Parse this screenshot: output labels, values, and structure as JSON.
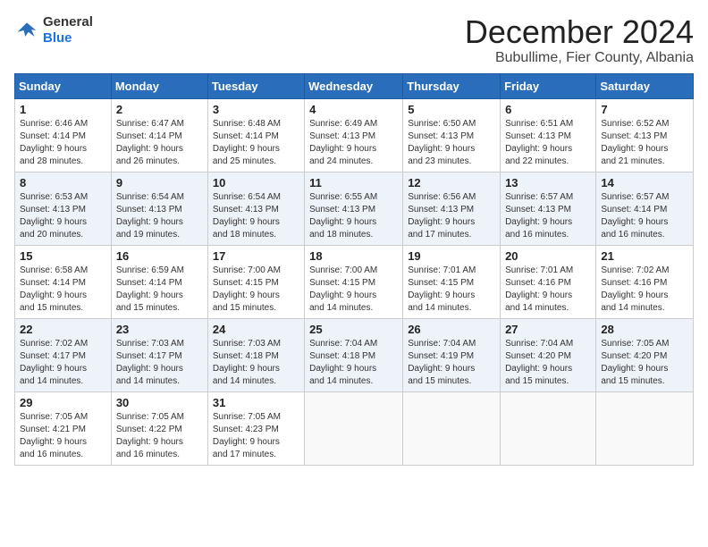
{
  "logo": {
    "line1": "General",
    "line2": "Blue"
  },
  "title": "December 2024",
  "location": "Bubullime, Fier County, Albania",
  "weekdays": [
    "Sunday",
    "Monday",
    "Tuesday",
    "Wednesday",
    "Thursday",
    "Friday",
    "Saturday"
  ],
  "weeks": [
    [
      {
        "day": "1",
        "text": "Sunrise: 6:46 AM\nSunset: 4:14 PM\nDaylight: 9 hours\nand 28 minutes."
      },
      {
        "day": "2",
        "text": "Sunrise: 6:47 AM\nSunset: 4:14 PM\nDaylight: 9 hours\nand 26 minutes."
      },
      {
        "day": "3",
        "text": "Sunrise: 6:48 AM\nSunset: 4:14 PM\nDaylight: 9 hours\nand 25 minutes."
      },
      {
        "day": "4",
        "text": "Sunrise: 6:49 AM\nSunset: 4:13 PM\nDaylight: 9 hours\nand 24 minutes."
      },
      {
        "day": "5",
        "text": "Sunrise: 6:50 AM\nSunset: 4:13 PM\nDaylight: 9 hours\nand 23 minutes."
      },
      {
        "day": "6",
        "text": "Sunrise: 6:51 AM\nSunset: 4:13 PM\nDaylight: 9 hours\nand 22 minutes."
      },
      {
        "day": "7",
        "text": "Sunrise: 6:52 AM\nSunset: 4:13 PM\nDaylight: 9 hours\nand 21 minutes."
      }
    ],
    [
      {
        "day": "8",
        "text": "Sunrise: 6:53 AM\nSunset: 4:13 PM\nDaylight: 9 hours\nand 20 minutes."
      },
      {
        "day": "9",
        "text": "Sunrise: 6:54 AM\nSunset: 4:13 PM\nDaylight: 9 hours\nand 19 minutes."
      },
      {
        "day": "10",
        "text": "Sunrise: 6:54 AM\nSunset: 4:13 PM\nDaylight: 9 hours\nand 18 minutes."
      },
      {
        "day": "11",
        "text": "Sunrise: 6:55 AM\nSunset: 4:13 PM\nDaylight: 9 hours\nand 18 minutes."
      },
      {
        "day": "12",
        "text": "Sunrise: 6:56 AM\nSunset: 4:13 PM\nDaylight: 9 hours\nand 17 minutes."
      },
      {
        "day": "13",
        "text": "Sunrise: 6:57 AM\nSunset: 4:13 PM\nDaylight: 9 hours\nand 16 minutes."
      },
      {
        "day": "14",
        "text": "Sunrise: 6:57 AM\nSunset: 4:14 PM\nDaylight: 9 hours\nand 16 minutes."
      }
    ],
    [
      {
        "day": "15",
        "text": "Sunrise: 6:58 AM\nSunset: 4:14 PM\nDaylight: 9 hours\nand 15 minutes."
      },
      {
        "day": "16",
        "text": "Sunrise: 6:59 AM\nSunset: 4:14 PM\nDaylight: 9 hours\nand 15 minutes."
      },
      {
        "day": "17",
        "text": "Sunrise: 7:00 AM\nSunset: 4:15 PM\nDaylight: 9 hours\nand 15 minutes."
      },
      {
        "day": "18",
        "text": "Sunrise: 7:00 AM\nSunset: 4:15 PM\nDaylight: 9 hours\nand 14 minutes."
      },
      {
        "day": "19",
        "text": "Sunrise: 7:01 AM\nSunset: 4:15 PM\nDaylight: 9 hours\nand 14 minutes."
      },
      {
        "day": "20",
        "text": "Sunrise: 7:01 AM\nSunset: 4:16 PM\nDaylight: 9 hours\nand 14 minutes."
      },
      {
        "day": "21",
        "text": "Sunrise: 7:02 AM\nSunset: 4:16 PM\nDaylight: 9 hours\nand 14 minutes."
      }
    ],
    [
      {
        "day": "22",
        "text": "Sunrise: 7:02 AM\nSunset: 4:17 PM\nDaylight: 9 hours\nand 14 minutes."
      },
      {
        "day": "23",
        "text": "Sunrise: 7:03 AM\nSunset: 4:17 PM\nDaylight: 9 hours\nand 14 minutes."
      },
      {
        "day": "24",
        "text": "Sunrise: 7:03 AM\nSunset: 4:18 PM\nDaylight: 9 hours\nand 14 minutes."
      },
      {
        "day": "25",
        "text": "Sunrise: 7:04 AM\nSunset: 4:18 PM\nDaylight: 9 hours\nand 14 minutes."
      },
      {
        "day": "26",
        "text": "Sunrise: 7:04 AM\nSunset: 4:19 PM\nDaylight: 9 hours\nand 15 minutes."
      },
      {
        "day": "27",
        "text": "Sunrise: 7:04 AM\nSunset: 4:20 PM\nDaylight: 9 hours\nand 15 minutes."
      },
      {
        "day": "28",
        "text": "Sunrise: 7:05 AM\nSunset: 4:20 PM\nDaylight: 9 hours\nand 15 minutes."
      }
    ],
    [
      {
        "day": "29",
        "text": "Sunrise: 7:05 AM\nSunset: 4:21 PM\nDaylight: 9 hours\nand 16 minutes."
      },
      {
        "day": "30",
        "text": "Sunrise: 7:05 AM\nSunset: 4:22 PM\nDaylight: 9 hours\nand 16 minutes."
      },
      {
        "day": "31",
        "text": "Sunrise: 7:05 AM\nSunset: 4:23 PM\nDaylight: 9 hours\nand 17 minutes."
      },
      {
        "day": "",
        "text": ""
      },
      {
        "day": "",
        "text": ""
      },
      {
        "day": "",
        "text": ""
      },
      {
        "day": "",
        "text": ""
      }
    ]
  ]
}
